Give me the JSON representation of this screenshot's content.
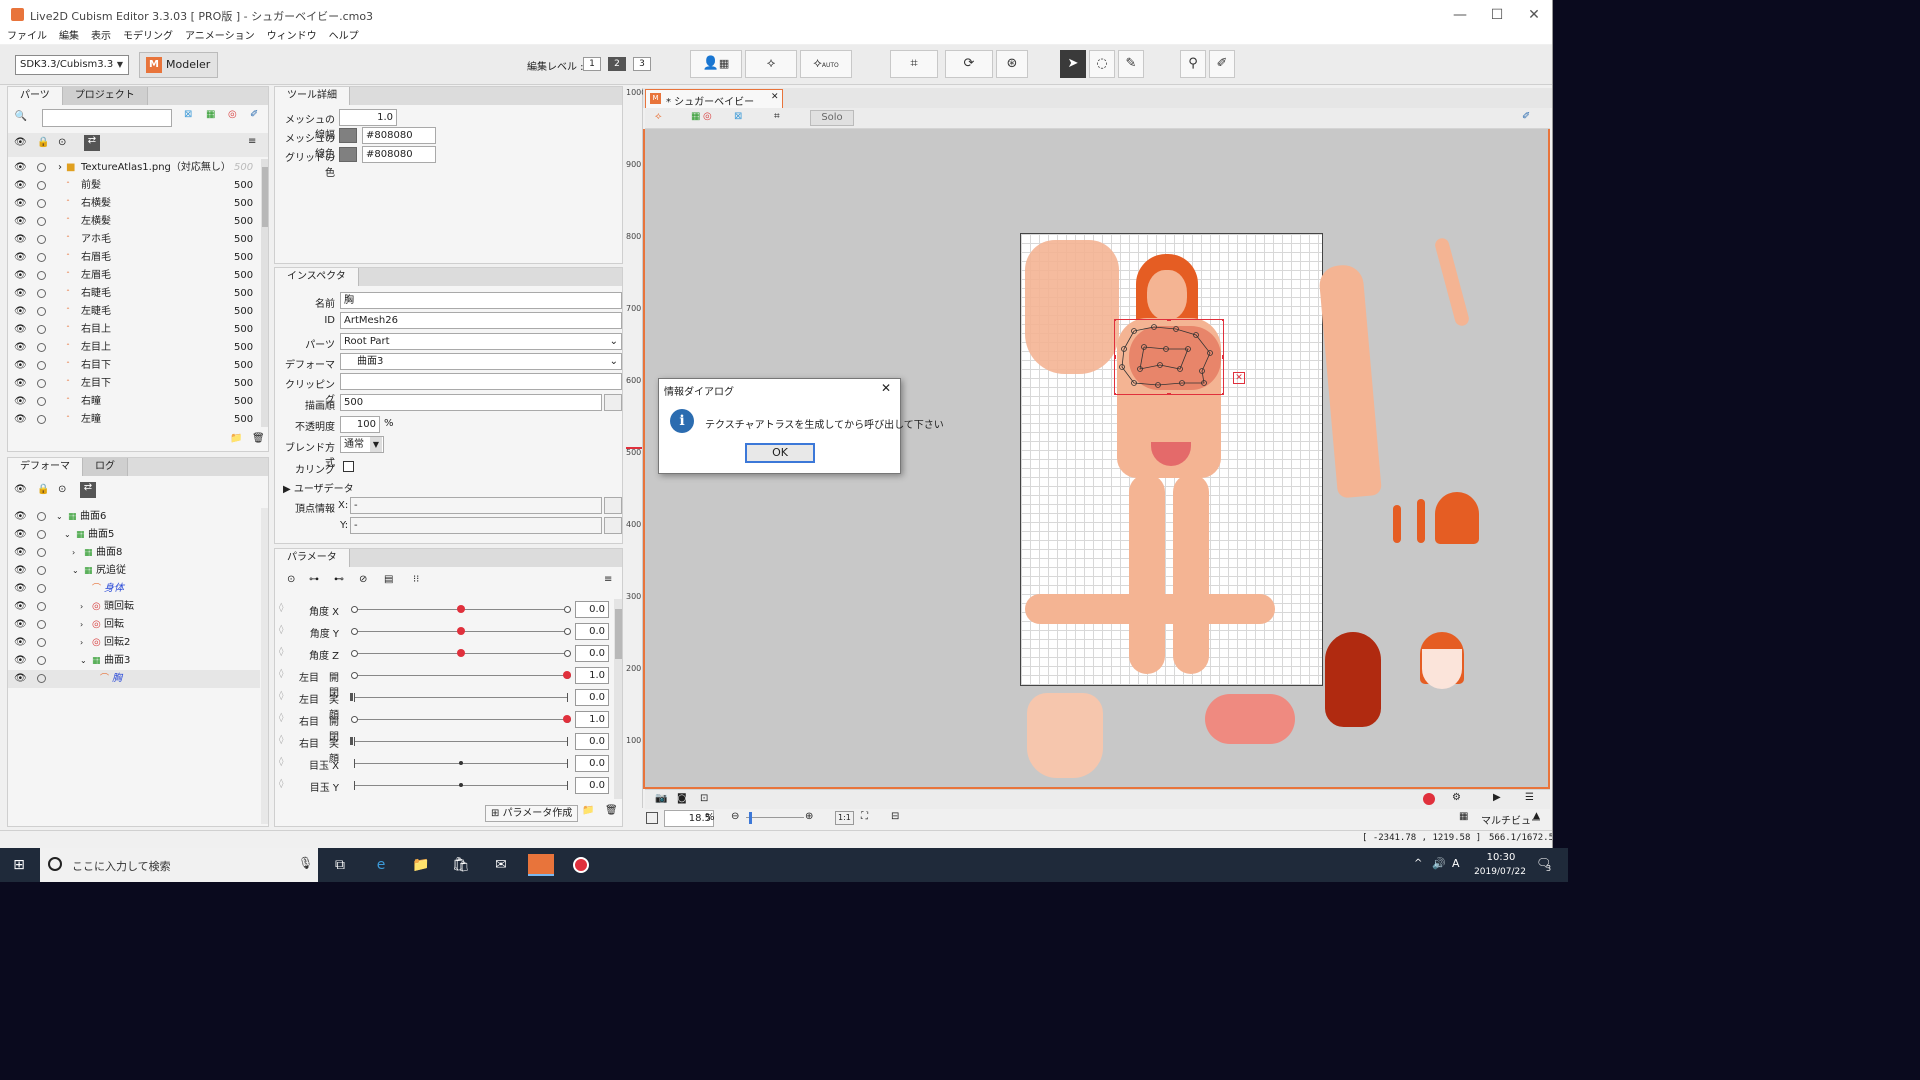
{
  "window": {
    "title": "Live2D Cubism Editor 3.3.03   [ PRO版 ]  - シュガーベイビー.cmo3",
    "controls": {
      "minimize": "—",
      "maximize": "☐",
      "close": "✕"
    }
  },
  "menu": [
    "ファイル",
    "編集",
    "表示",
    "モデリング",
    "アニメーション",
    "ウィンドウ",
    "ヘルプ"
  ],
  "toolbar": {
    "sdk_select": "SDK3.3/Cubism3.3",
    "mode_letter": "M",
    "mode_label": "Modeler",
    "edit_level_label": "編集レベル :",
    "edit_levels": [
      "1",
      "2",
      "3"
    ],
    "selected_level": "2",
    "auto_label": "AUTO"
  },
  "parts_panel": {
    "tabs": [
      "パーツ",
      "プロジェクト"
    ],
    "items": [
      {
        "name": "TextureAtlas1.png（対応無し）",
        "value": "500"
      },
      {
        "name": "前髪",
        "value": "500"
      },
      {
        "name": "右横髪",
        "value": "500"
      },
      {
        "name": "左横髪",
        "value": "500"
      },
      {
        "name": "アホ毛",
        "value": "500"
      },
      {
        "name": "右眉毛",
        "value": "500"
      },
      {
        "name": "左眉毛",
        "value": "500"
      },
      {
        "name": "右睫毛",
        "value": "500"
      },
      {
        "name": "左睫毛",
        "value": "500"
      },
      {
        "name": "右目上",
        "value": "500"
      },
      {
        "name": "左目上",
        "value": "500"
      },
      {
        "name": "右目下",
        "value": "500"
      },
      {
        "name": "左目下",
        "value": "500"
      },
      {
        "name": "右瞳",
        "value": "500"
      },
      {
        "name": "左瞳",
        "value": "500"
      }
    ]
  },
  "deformer_panel": {
    "tabs": [
      "デフォーマ",
      "ログ"
    ],
    "items": [
      {
        "name": "曲面6",
        "indent": 0,
        "open": "v"
      },
      {
        "name": "曲面5",
        "indent": 1,
        "open": "v"
      },
      {
        "name": "曲面8",
        "indent": 2,
        "open": ">"
      },
      {
        "name": "尻追従",
        "indent": 2,
        "open": "v"
      },
      {
        "name": "身体",
        "indent": 3,
        "open": ""
      },
      {
        "name": "頭回転",
        "indent": 3,
        "open": ">"
      },
      {
        "name": "回転",
        "indent": 3,
        "open": ">"
      },
      {
        "name": "回転2",
        "indent": 3,
        "open": ">"
      },
      {
        "name": "曲面3",
        "indent": 3,
        "open": "v"
      },
      {
        "name": "胸",
        "indent": 4,
        "open": ""
      }
    ]
  },
  "tool_detail": {
    "title": "ツール詳細",
    "line_width_label": "メッシュの線幅",
    "line_width": "1.0",
    "line_color_label": "メッシュの線色",
    "line_color": "#808080",
    "grid_color_label": "グリッドの色",
    "grid_color": "#808080"
  },
  "inspector": {
    "title": "インスペクタ",
    "name_label": "名前",
    "name": "胸",
    "id_label": "ID",
    "id": "ArtMesh26",
    "part_label": "パーツ",
    "part": "Root Part",
    "deformer_label": "デフォーマ",
    "deformer": "曲面3",
    "clipping_label": "クリッピング",
    "clipping": "",
    "draw_order_label": "描画順",
    "draw_order": "500",
    "opacity_label": "不透明度",
    "opacity": "100",
    "opacity_unit": "%",
    "blend_label": "ブレンド方式",
    "blend": "通常",
    "culling_label": "カリング",
    "userdata_label": "ユーザデータ",
    "vertex_label": "頂点情報",
    "vx_label": "X:",
    "vx": "-",
    "vy_label": "Y:",
    "vy": "-"
  },
  "parameters": {
    "title": "パラメータ",
    "items": [
      {
        "name": "角度 X",
        "value": "0.0",
        "pos": 0.5,
        "keys": true
      },
      {
        "name": "角度 Y",
        "value": "0.0",
        "pos": 0.5,
        "keys": true
      },
      {
        "name": "角度 Z",
        "value": "0.0",
        "pos": 0.5,
        "keys": true
      },
      {
        "name": "左目　開閉",
        "value": "1.0",
        "pos": 1.0,
        "keys": true
      },
      {
        "name": "左目　笑顔",
        "value": "0.0",
        "pos": 0.0,
        "keys": false
      },
      {
        "name": "右目　開閉",
        "value": "1.0",
        "pos": 1.0,
        "keys": true
      },
      {
        "name": "右目　笑顔",
        "value": "0.0",
        "pos": 0.0,
        "keys": false
      },
      {
        "name": "目玉 X",
        "value": "0.0",
        "pos": 0.5,
        "keys": false
      },
      {
        "name": "目玉 Y",
        "value": "0.0",
        "pos": 0.5,
        "keys": false
      }
    ],
    "create_button": "パラメータ作成"
  },
  "view": {
    "tab_title": "* シュガーベイビー",
    "solo_label": "Solo",
    "ruler_ticks": [
      "1000",
      "900",
      "800",
      "700",
      "600",
      "500",
      "400",
      "300",
      "200",
      "100"
    ],
    "zoom": "18.5",
    "zoom_unit": "%",
    "ratio_label": "1:1",
    "multiview_label": "マルチビュー",
    "coords": "[ -2341.78 , 1219.58 ]",
    "scale_readout": "566.1/1672.5"
  },
  "dialog": {
    "title": "情報ダイアログ",
    "message": "テクスチャアトラスを生成してから呼び出して下さい",
    "ok": "OK"
  },
  "taskbar": {
    "search_placeholder": "ここに入力して検索",
    "time": "10:30",
    "date": "2019/07/22",
    "notification_count": "3"
  },
  "colors": {
    "accent": "#e8743b",
    "key_red": "#e0303c",
    "selection_blue": "#3c78d8"
  }
}
